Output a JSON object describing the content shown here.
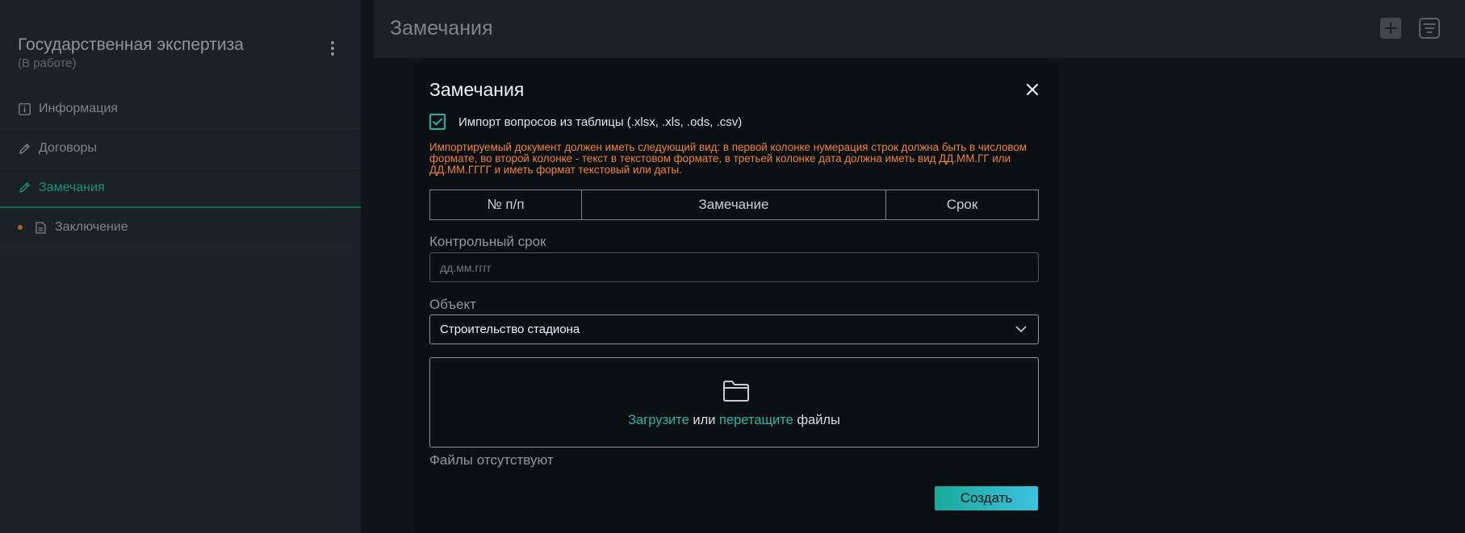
{
  "sidebar": {
    "project_title": "Государственная экспертиза",
    "project_status": "(В работе)",
    "items": [
      {
        "label": "Информация",
        "icon": "info-icon"
      },
      {
        "label": "Договоры",
        "icon": "pen-icon"
      },
      {
        "label": "Замечания",
        "icon": "pen-icon",
        "active": true
      },
      {
        "label": "Заключение",
        "icon": "document-icon"
      }
    ]
  },
  "topbar": {
    "title": "Замечания",
    "icons": [
      "add-icon",
      "filter-icon"
    ]
  },
  "modal": {
    "title": "Замечания",
    "import_checkbox": {
      "label": "Импорт вопросов из таблицы (.xlsx, .xls, .ods, .csv)",
      "checked": true
    },
    "warning": "Импортируемый документ должен иметь следующий вид: в первой колонке нумерация строк должна быть в числовом формате, во второй колонке - текст в текстовом формате, в третьей колонке дата должна иметь вид ДД.ММ.ГГ или ДД.ММ.ГГГГ и иметь формат текстовый или даты.",
    "table_headers": [
      "№ п/п",
      "Замечание",
      "Срок"
    ],
    "deadline": {
      "label": "Контрольный срок",
      "placeholder": "дд.мм.гггг",
      "value": ""
    },
    "object": {
      "label": "Объект",
      "selected": "Строительство стадиона"
    },
    "dropzone": {
      "upload_link": "Загрузите",
      "or": " или ",
      "drag_link": "перетащите",
      "suffix": " файлы"
    },
    "no_files": "Файлы отсутствуют",
    "create_button": "Создать"
  },
  "colors": {
    "accent": "#28b8a0",
    "warning": "#f0842a",
    "button_gradient_start": "#17a99b",
    "button_gradient_end": "#3ec2e0"
  }
}
